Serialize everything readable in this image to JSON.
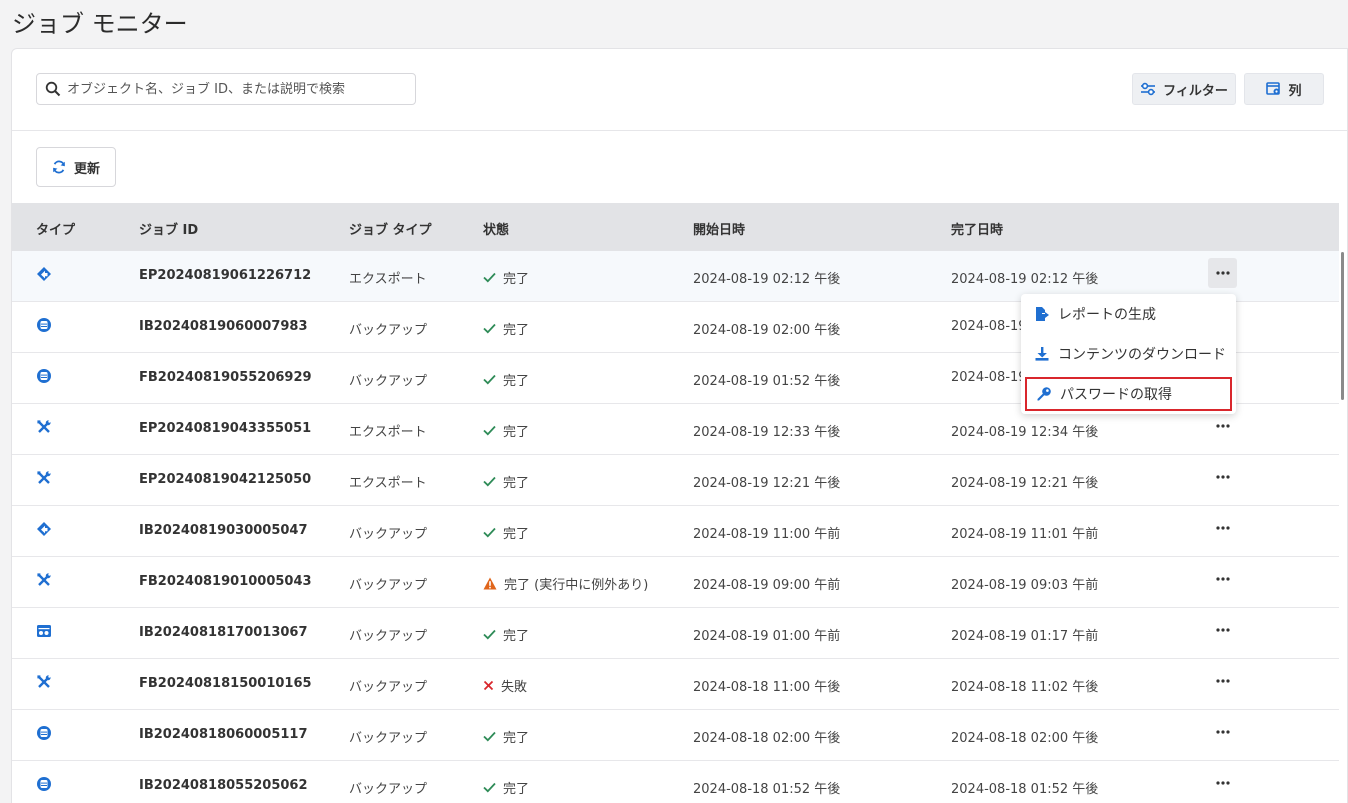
{
  "page": {
    "title": "ジョブ モニター"
  },
  "search": {
    "placeholder": "オブジェクト名、ジョブ ID、または説明で検索"
  },
  "toolbar": {
    "filter_label": "フィルター",
    "columns_label": "列",
    "refresh_label": "更新"
  },
  "table": {
    "headers": {
      "type": "タイプ",
      "job_id": "ジョブ ID",
      "job_type": "ジョブ タイプ",
      "status": "状態",
      "start": "開始日時",
      "end": "完了日時"
    },
    "rows": [
      {
        "icon": "diamond-arrow-icon",
        "job_id": "EP20240819061226712",
        "job_type": "エクスポート",
        "status": "完了",
        "status_kind": "success",
        "start": "2024-08-19 02:12 午後",
        "end": "2024-08-19 02:12 午後"
      },
      {
        "icon": "database-icon",
        "job_id": "IB20240819060007983",
        "job_type": "バックアップ",
        "status": "完了",
        "status_kind": "success",
        "start": "2024-08-19 02:00 午後",
        "end": "2024-08-19"
      },
      {
        "icon": "database-icon",
        "job_id": "FB20240819055206929",
        "job_type": "バックアップ",
        "status": "完了",
        "status_kind": "success",
        "start": "2024-08-19 01:52 午後",
        "end": "2024-08-19"
      },
      {
        "icon": "tools-icon",
        "job_id": "EP20240819043355051",
        "job_type": "エクスポート",
        "status": "完了",
        "status_kind": "success",
        "start": "2024-08-19 12:33 午後",
        "end": "2024-08-19 12:34 午後"
      },
      {
        "icon": "tools-icon",
        "job_id": "EP20240819042125050",
        "job_type": "エクスポート",
        "status": "完了",
        "status_kind": "success",
        "start": "2024-08-19 12:21 午後",
        "end": "2024-08-19 12:21 午後"
      },
      {
        "icon": "diamond-arrow-icon",
        "job_id": "IB20240819030005047",
        "job_type": "バックアップ",
        "status": "完了",
        "status_kind": "success",
        "start": "2024-08-19 11:00 午前",
        "end": "2024-08-19 11:01 午前"
      },
      {
        "icon": "tools-icon",
        "job_id": "FB20240819010005043",
        "job_type": "バックアップ",
        "status": "完了 (実行中に例外あり)",
        "status_kind": "warning",
        "start": "2024-08-19 09:00 午前",
        "end": "2024-08-19 09:03 午前"
      },
      {
        "icon": "server-icon",
        "job_id": "IB20240818170013067",
        "job_type": "バックアップ",
        "status": "完了",
        "status_kind": "success",
        "start": "2024-08-19 01:00 午前",
        "end": "2024-08-19 01:17 午前"
      },
      {
        "icon": "tools-icon",
        "job_id": "FB20240818150010165",
        "job_type": "バックアップ",
        "status": "失敗",
        "status_kind": "failed",
        "start": "2024-08-18 11:00 午後",
        "end": "2024-08-18 11:02 午後"
      },
      {
        "icon": "database-icon",
        "job_id": "IB20240818060005117",
        "job_type": "バックアップ",
        "status": "完了",
        "status_kind": "success",
        "start": "2024-08-18 02:00 午後",
        "end": "2024-08-18 02:00 午後"
      },
      {
        "icon": "database-icon",
        "job_id": "IB20240818055205062",
        "job_type": "バックアップ",
        "status": "完了",
        "status_kind": "success",
        "start": "2024-08-18 01:52 午後",
        "end": "2024-08-18 01:52 午後"
      }
    ]
  },
  "context_menu": {
    "items": [
      {
        "label": "レポートの生成",
        "icon": "report-export-icon"
      },
      {
        "label": "コンテンツのダウンロード",
        "icon": "download-icon"
      },
      {
        "label": "パスワードの取得",
        "icon": "key-icon",
        "selected": true
      }
    ]
  },
  "colors": {
    "accent": "#1f6fd1",
    "success": "#2e8b57",
    "warning": "#e0651b",
    "failed": "#d9262c",
    "highlight_border": "#d9262c"
  }
}
